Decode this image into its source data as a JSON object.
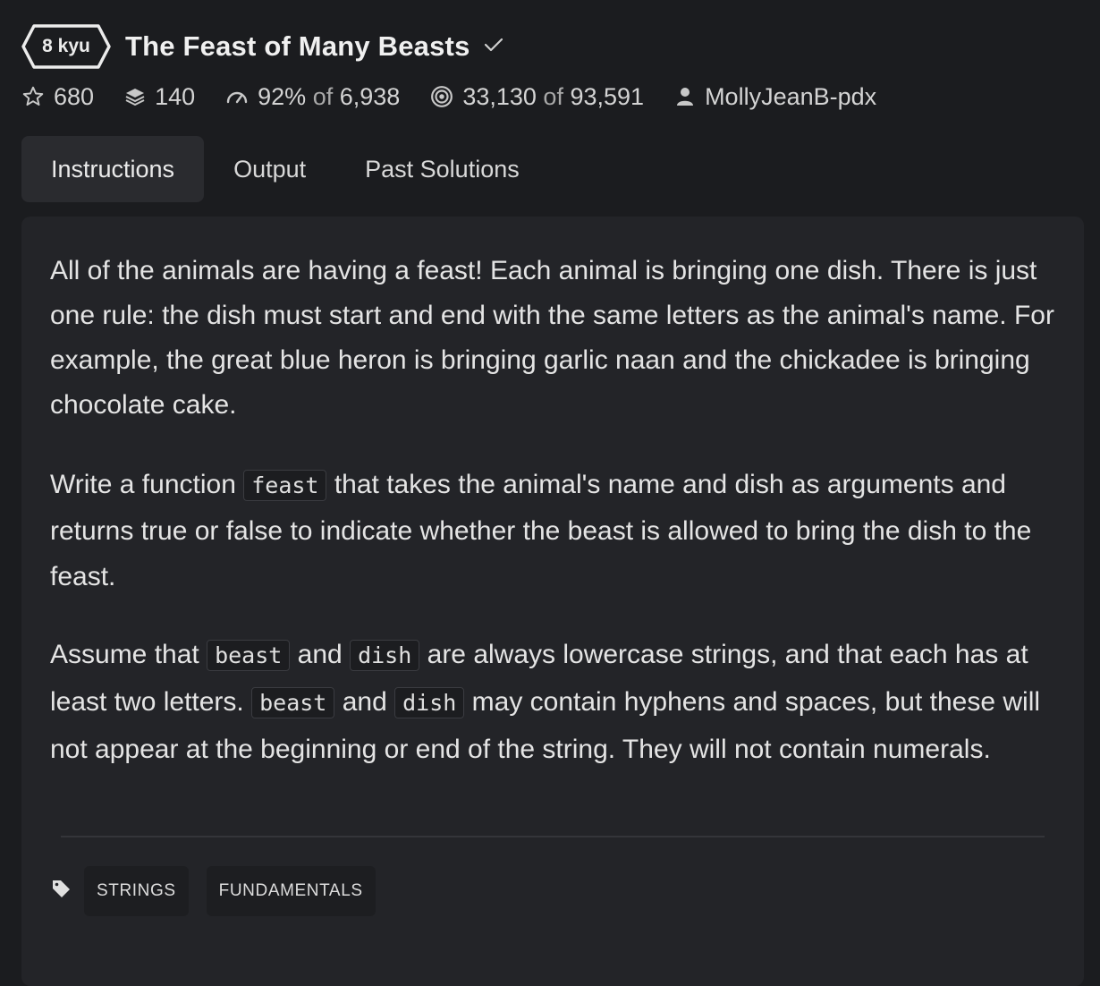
{
  "kata": {
    "rank": "8 kyu",
    "title": "The Feast of Many Beasts"
  },
  "stats": {
    "stars": "680",
    "collections": "140",
    "satisfaction": "92%",
    "of_label": "of",
    "votes": "6,938",
    "completed": "33,130",
    "attempts": "93,591",
    "author": "MollyJeanB-pdx"
  },
  "tabs": [
    {
      "label": "Instructions",
      "active": true
    },
    {
      "label": "Output",
      "active": false
    },
    {
      "label": "Past Solutions",
      "active": false
    }
  ],
  "instructions": {
    "p1": "All of the animals are having a feast! Each animal is bringing one dish. There is just one rule: the dish must start and end with the same letters as the animal's name. For example, the great blue heron is bringing garlic naan and the chickadee is bringing chocolate cake.",
    "p2_a": "Write a function ",
    "p2_code": "feast",
    "p2_b": " that takes the animal's name and dish as arguments and returns true or false to indicate whether the beast is allowed to bring the dish to the feast.",
    "p3_a": "Assume that ",
    "p3_code1": "beast",
    "p3_b": " and ",
    "p3_code2": "dish",
    "p3_c": " are always lowercase strings, and that each has at least two letters. ",
    "p3_code3": "beast",
    "p3_d": " and ",
    "p3_code4": "dish",
    "p3_e": " may contain hyphens and spaces, but these will not appear at the beginning or end of the string. They will not contain numerals."
  },
  "tags": [
    "STRINGS",
    "FUNDAMENTALS"
  ],
  "icons": {
    "rank": "hexagon-badge-icon",
    "completed_check": "checkmark-icon",
    "stars": "star-outline-icon",
    "collections": "layers-icon",
    "satisfaction": "gauge-icon",
    "completed": "target-icon",
    "author": "user-icon",
    "tags": "tag-icon"
  },
  "colors": {
    "background": "#1b1c1f",
    "card": "#232428",
    "active_tab": "#2a2b2f",
    "text": "#e6e6e6"
  }
}
